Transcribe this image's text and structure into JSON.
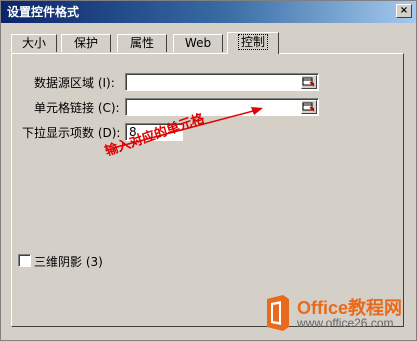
{
  "window": {
    "title": "设置控件格式",
    "close_label": "×"
  },
  "tabs": [
    {
      "label": "大小",
      "active": false
    },
    {
      "label": "保护",
      "active": false
    },
    {
      "label": "属性",
      "active": false
    },
    {
      "label": "Web",
      "active": false
    },
    {
      "label": "控制",
      "active": true
    }
  ],
  "form": {
    "source_range_label": "数据源区域 (I):",
    "source_range_value": "",
    "cell_link_label": "单元格链接 (C):",
    "cell_link_value": "",
    "dropdown_lines_label": "下拉显示项数 (D):",
    "dropdown_lines_value": "8",
    "shading_3d_label": "三维阴影 (3)",
    "shading_3d_checked": false
  },
  "annotation": {
    "text": "输入对应的单元格",
    "color": "#e00000"
  },
  "watermark": {
    "brand": "Office教程网",
    "url": "www.office26.com",
    "brand_color": "#e86a1c"
  }
}
